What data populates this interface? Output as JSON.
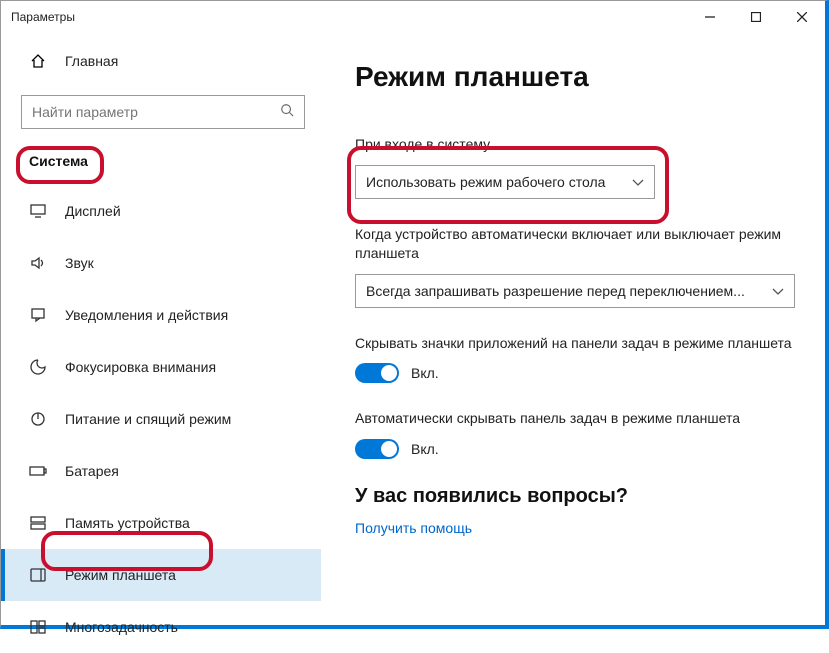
{
  "window": {
    "title": "Параметры"
  },
  "home": {
    "label": "Главная"
  },
  "search": {
    "placeholder": "Найти параметр"
  },
  "section": {
    "title": "Система"
  },
  "nav": {
    "display": "Дисплей",
    "sound": "Звук",
    "notifications": "Уведомления и действия",
    "focus": "Фокусировка внимания",
    "power": "Питание и спящий режим",
    "battery": "Батарея",
    "storage": "Память устройства",
    "tablet": "Режим планшета",
    "multitask": "Многозадачность"
  },
  "page": {
    "title": "Режим планшета"
  },
  "signin": {
    "label": "При входе в систему",
    "value": "Использовать режим рабочего стола"
  },
  "auto": {
    "label": "Когда устройство автоматически включает или выключает режим планшета",
    "value": "Всегда запрашивать разрешение перед переключением..."
  },
  "hideicons": {
    "label": "Скрывать значки приложений на панели задач в режиме планшета",
    "state": "Вкл."
  },
  "hidetaskbar": {
    "label": "Автоматически скрывать панель задач в режиме планшета",
    "state": "Вкл."
  },
  "help": {
    "title": "У вас появились вопросы?",
    "link": "Получить помощь"
  }
}
